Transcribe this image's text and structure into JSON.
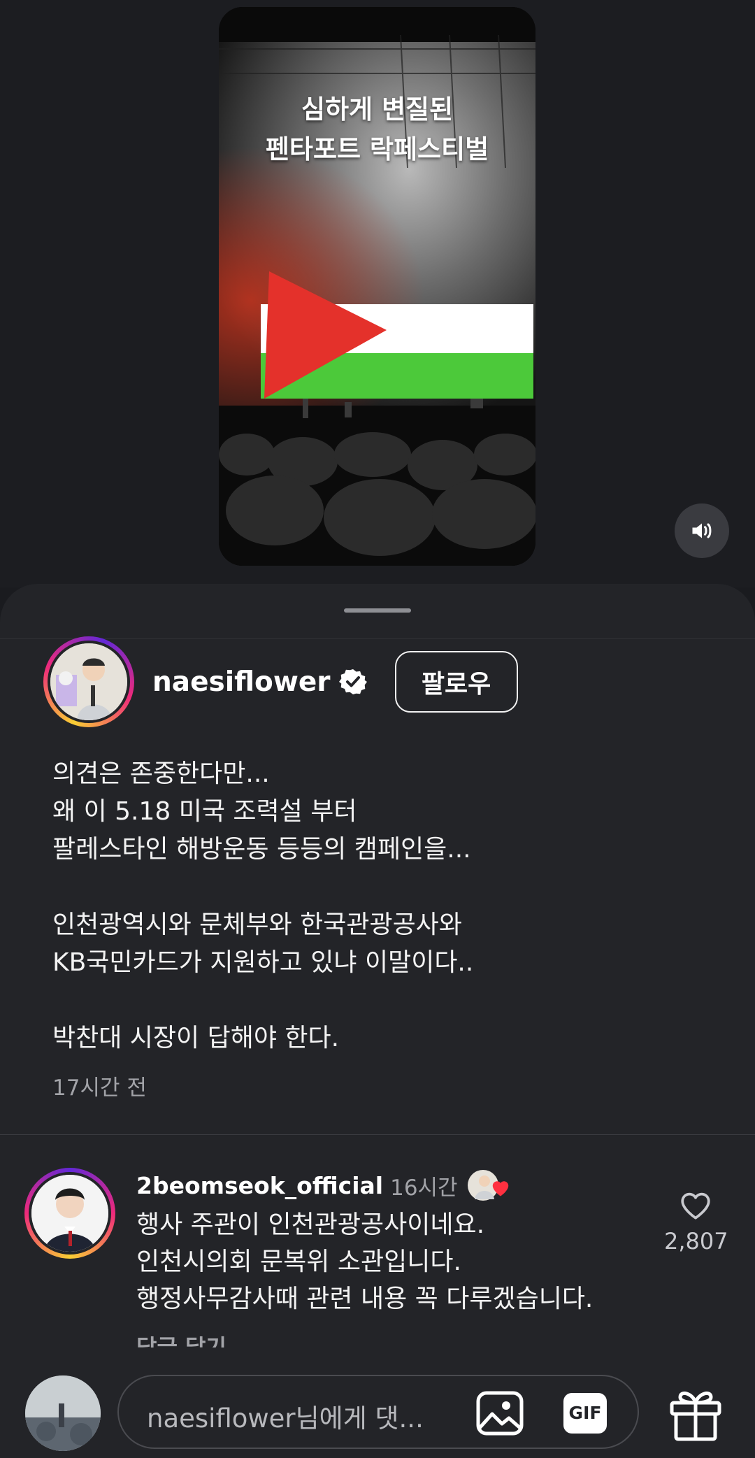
{
  "video": {
    "overlay_line1": "심하게 변질된",
    "overlay_line2": "펜타포트 락페스티벌",
    "volume_icon": "volume-icon"
  },
  "post": {
    "username": "naesiflower",
    "verified": true,
    "follow_label": "팔로우",
    "caption": "의견은 존중한다만...\n왜 이 5.18 미국 조력설 부터\n팔레스타인 해방운동 등등의 캠페인을...\n\n인천광역시와 문체부와 한국관광공사와\nKB국민카드가 지원하고 있냐 이말이다..\n\n박찬대 시장이 답해야 한다.",
    "time": "17시간 전"
  },
  "comment": {
    "username": "2beomseok_official",
    "time": "16시간",
    "text": "행사 주관이 인천관광공사이네요.\n인천시의회 문복위 소관입니다.\n행정사무감사때 관련 내용 꼭 다루겠습니다.",
    "more_label": "답글 달기",
    "like_count": "2,807"
  },
  "composer": {
    "placeholder": "naesiflower님에게 댓...",
    "gif_label": "GIF"
  },
  "colors": {
    "background": "#1a1b1f",
    "sheet": "#232428",
    "like_heart": "#ff3040",
    "flag_red": "#e4312b",
    "flag_green": "#4cc93a"
  }
}
